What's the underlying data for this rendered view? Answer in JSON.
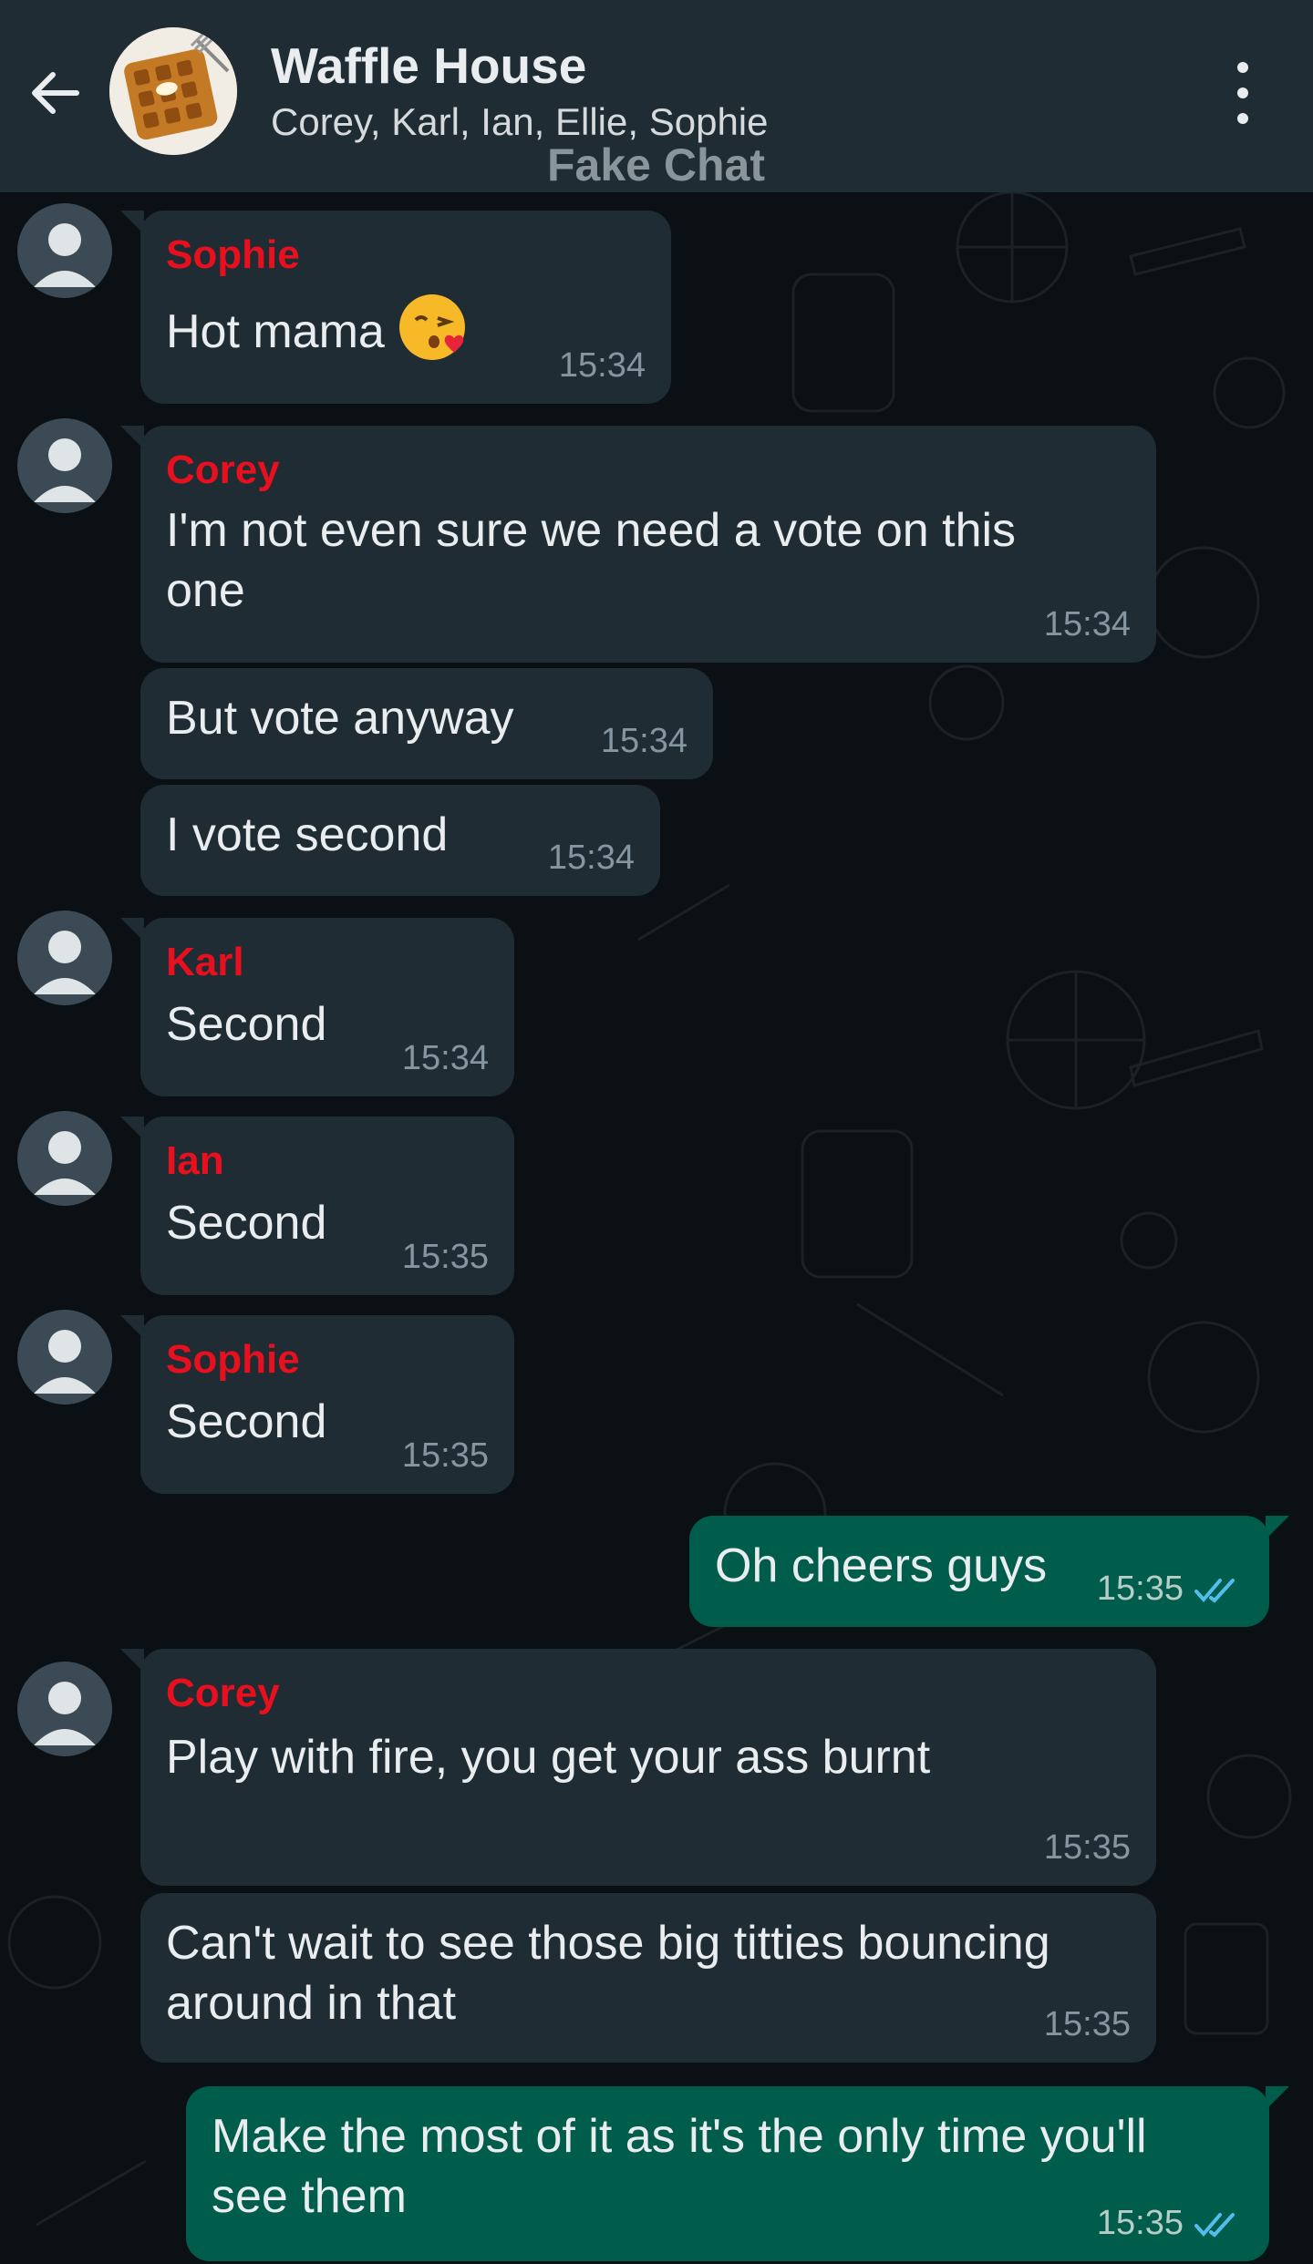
{
  "header": {
    "title": "Waffle House",
    "members": "Corey, Karl, Ian, Ellie, Sophie",
    "watermark": "Fake Chat",
    "icons": {
      "back": "arrow-left-icon",
      "menu": "more-vertical-icon",
      "group_avatar": "waffle-photo"
    }
  },
  "colors": {
    "header_bg": "#1f2c34",
    "chat_bg": "#0b1014",
    "incoming_bubble": "#1f2c33",
    "outgoing_bubble": "#005c4b",
    "sender_name": "#e8101e",
    "read_ticks": "#53bdeb"
  },
  "messages": [
    {
      "sender": "Sophie",
      "text": "Hot mama",
      "emoji": "kissing-face-with-heart",
      "time": "15:34"
    },
    {
      "sender": "Corey",
      "text": "I'm not even sure we need a vote on this one",
      "time": "15:34"
    },
    {
      "text": "But vote anyway",
      "time": "15:34"
    },
    {
      "text": "I vote second",
      "time": "15:34"
    },
    {
      "sender": "Karl",
      "text": "Second",
      "time": "15:34"
    },
    {
      "sender": "Ian",
      "text": "Second",
      "time": "15:35"
    },
    {
      "sender": "Sophie",
      "text": "Second",
      "time": "15:35"
    },
    {
      "text": "Oh cheers guys",
      "time": "15:35",
      "status": "read"
    },
    {
      "sender": "Corey",
      "text": "Play with fire, you get your ass burnt",
      "time": "15:35"
    },
    {
      "text": "Can't wait to see those big titties bouncing around in that",
      "time": "15:35"
    },
    {
      "text": "Make the most of it as it's the only time you'll see them",
      "time": "15:35",
      "status": "read"
    }
  ]
}
